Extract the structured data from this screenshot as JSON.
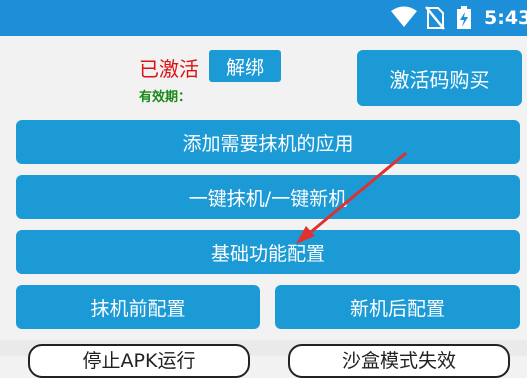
{
  "status_bar": {
    "time": "5:43"
  },
  "activation": {
    "status": "已激活",
    "unbind_label": "解绑",
    "validity_label": "有效期："
  },
  "buy_code_label": "激活码购买",
  "buttons": {
    "add_apps": "添加需要抹机的应用",
    "one_click": "一键抹机/一键新机",
    "basic_config": "基础功能配置",
    "before_config": "抹机前配置",
    "after_config": "新机后配置",
    "stop_apk": "停止APK运行",
    "stealth_mode": "沙盒模式失效"
  },
  "colors": {
    "status_bar": "#1d8ed8",
    "button": "#1b9ad6",
    "activated_text": "#dd1111",
    "validity_text": "#188a18",
    "arrow": "#e03030"
  }
}
